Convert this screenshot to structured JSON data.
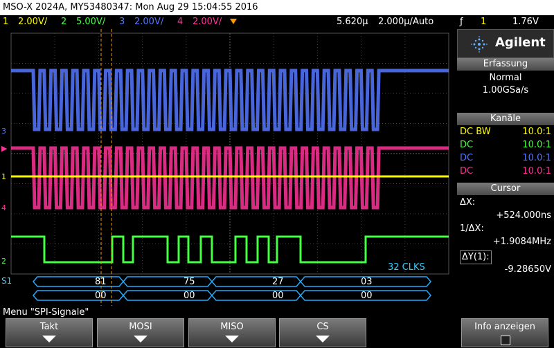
{
  "titlebar": {
    "text": "MSO-X 2024A, MY53480347: Mon Aug 29 15:04:55 2016"
  },
  "channels": [
    {
      "num": "1",
      "scale": "2.00V/",
      "color": "#ffff00"
    },
    {
      "num": "2",
      "scale": "5.00V/",
      "color": "#44ff44"
    },
    {
      "num": "3",
      "scale": "2.00V/",
      "color": "#5577ff"
    },
    {
      "num": "4",
      "scale": "2.00V/",
      "color": "#ff3399"
    }
  ],
  "timebase": {
    "delay": "5.620µ",
    "scale": "2.000µ/",
    "mode": "Auto",
    "trigger_symbol": "ƒ",
    "trigger_channel": "1",
    "trigger_level": "1.76V"
  },
  "brand": {
    "name": "Agilent"
  },
  "acquisition": {
    "title": "Erfassung",
    "mode": "Normal",
    "rate": "1.00GSa/s"
  },
  "channels_panel": {
    "title": "Kanäle",
    "rows": [
      {
        "coupling": "DC",
        "extra": "BW",
        "probe": "10.0:1",
        "color": "#ffff00"
      },
      {
        "coupling": "DC",
        "extra": "",
        "probe": "10.0:1",
        "color": "#44ff44"
      },
      {
        "coupling": "DC",
        "extra": "",
        "probe": "10.0:1",
        "color": "#5577ff"
      },
      {
        "coupling": "DC",
        "extra": "",
        "probe": "10.0:1",
        "color": "#ff3399"
      }
    ]
  },
  "cursor": {
    "title": "Cursor",
    "dx_label": "ΔX:",
    "dx_value": "+524.000ns",
    "inv_label": "1/ΔX:",
    "inv_value": "+1.9084MHz",
    "dy_label": "ΔY(1):",
    "dy_value": "-9.28650V"
  },
  "serial": {
    "label": "S1",
    "clks": "32 CLKS",
    "mosi": [
      "81",
      "75",
      "27",
      "03"
    ],
    "miso": [
      "00",
      "00",
      "00",
      "00"
    ]
  },
  "menu": {
    "title": "Menu \"SPI-Signale\"",
    "softkeys": [
      "Takt",
      "MOSI",
      "MISO",
      "CS",
      "Info anzeigen"
    ]
  },
  "colors": {
    "ch1": "#ffff00",
    "ch2": "#44ff44",
    "ch3": "#5577ff",
    "ch4": "#ff3399",
    "cursor": "#ff9900",
    "bus": "#22aaff",
    "serial_text": "#33ccff"
  }
}
